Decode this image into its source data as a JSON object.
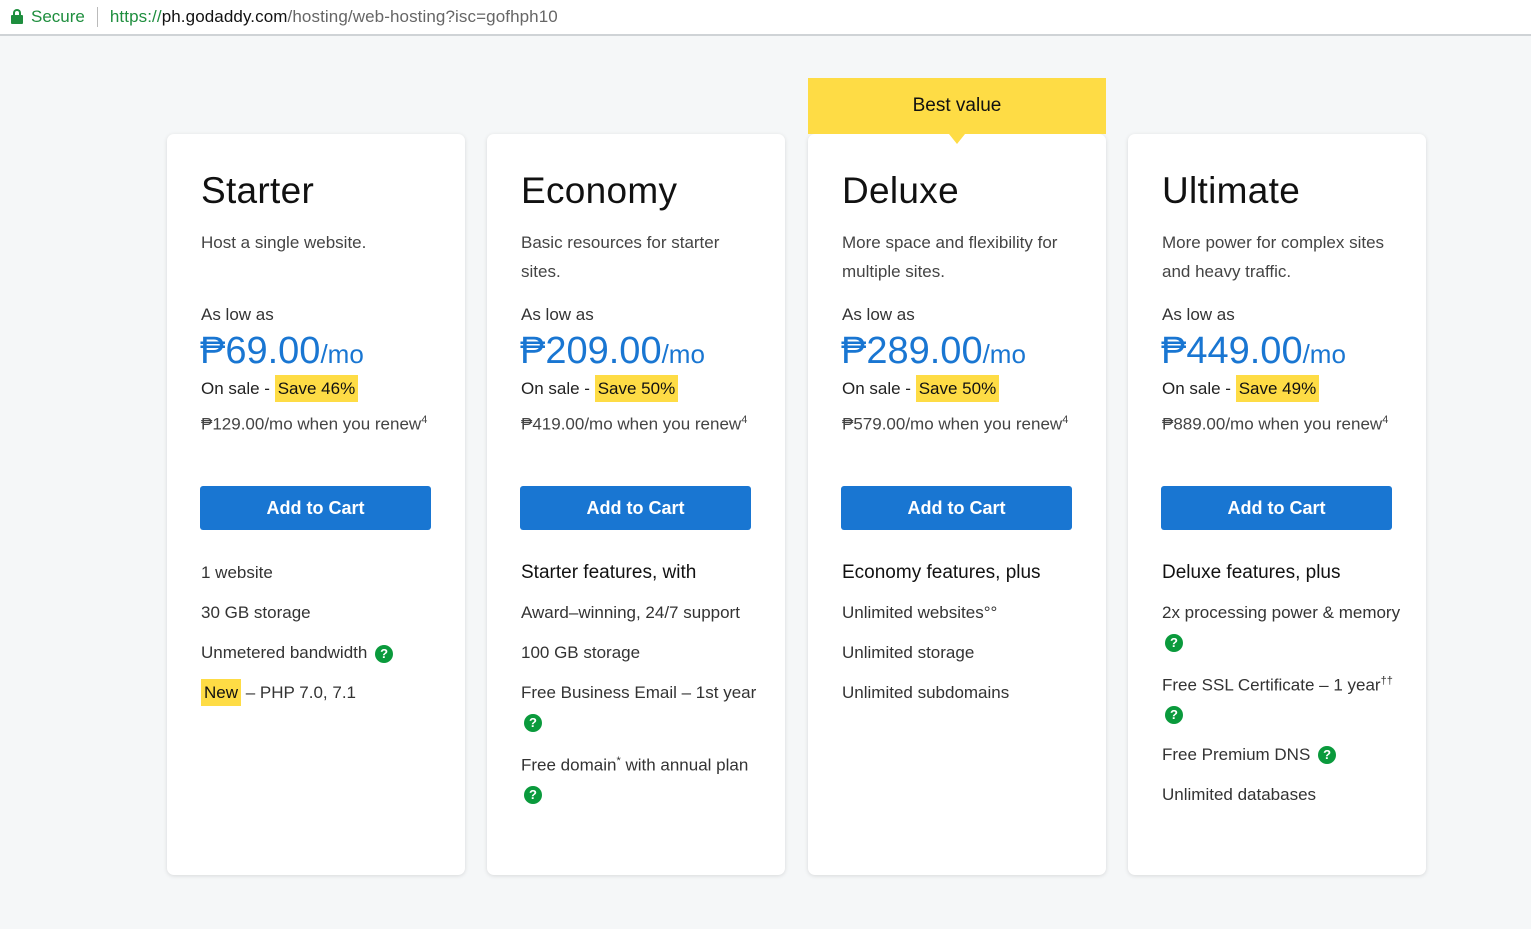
{
  "browser": {
    "secure_label": "Secure",
    "url_scheme": "https://",
    "url_host": "ph.godaddy.com",
    "url_path": "/hosting/web-hosting?isc=gofhph10"
  },
  "colors": {
    "accent_blue": "#1976d2",
    "highlight_yellow": "#fedc45",
    "help_green": "#0a9a3c"
  },
  "banner": {
    "label": "Best value"
  },
  "plans": [
    {
      "name": "Starter",
      "description": "Host a single website.",
      "as_low_as": "As low as",
      "price": "₱69.00",
      "per": "/mo",
      "on_sale": "On sale - ",
      "save": "Save 46%",
      "renew": "₱129.00/mo when you renew",
      "renew_note": "4",
      "button": "Add to Cart",
      "features": [
        {
          "text": "1 website"
        },
        {
          "text": "30 GB storage"
        },
        {
          "text": "Unmetered bandwidth",
          "help": "?"
        },
        {
          "tag": "New",
          "text": " – PHP 7.0, 7.1"
        }
      ]
    },
    {
      "name": "Economy",
      "description": "Basic resources for starter sites.",
      "as_low_as": "As low as",
      "price": "₱209.00",
      "per": "/mo",
      "on_sale": "On sale - ",
      "save": "Save 50%",
      "renew": "₱419.00/mo when you renew",
      "renew_note": "4",
      "button": "Add to Cart",
      "heading": "Starter features, with",
      "features": [
        {
          "text": "Award–winning, 24/7 support"
        },
        {
          "text": "100 GB storage"
        },
        {
          "text": "Free Business Email – 1st year",
          "help": "?"
        },
        {
          "text": "Free domain",
          "note": "*",
          "text2": " with annual plan",
          "help": "?"
        }
      ]
    },
    {
      "name": "Deluxe",
      "description": "More space and flexibility for multiple sites.",
      "as_low_as": "As low as",
      "price": "₱289.00",
      "per": "/mo",
      "on_sale": "On sale - ",
      "save": "Save 50%",
      "renew": "₱579.00/mo when you renew",
      "renew_note": "4",
      "button": "Add to Cart",
      "heading": "Economy features, plus",
      "features": [
        {
          "text": "Unlimited websites°°"
        },
        {
          "text": "Unlimited storage"
        },
        {
          "text": "Unlimited subdomains"
        }
      ]
    },
    {
      "name": "Ultimate",
      "description": "More power for complex sites and heavy traffic.",
      "as_low_as": "As low as",
      "price": "₱449.00",
      "per": "/mo",
      "on_sale": "On sale - ",
      "save": "Save 49%",
      "renew": "₱889.00/mo when you renew",
      "renew_note": "4",
      "button": "Add to Cart",
      "heading": "Deluxe features, plus",
      "features": [
        {
          "text": "2x processing power & memory",
          "help": "?"
        },
        {
          "text": "Free SSL Certificate – 1 year",
          "note": "††",
          "help": "?"
        },
        {
          "text": "Free Premium DNS",
          "help": "?"
        },
        {
          "text": "Unlimited databases"
        }
      ]
    }
  ]
}
